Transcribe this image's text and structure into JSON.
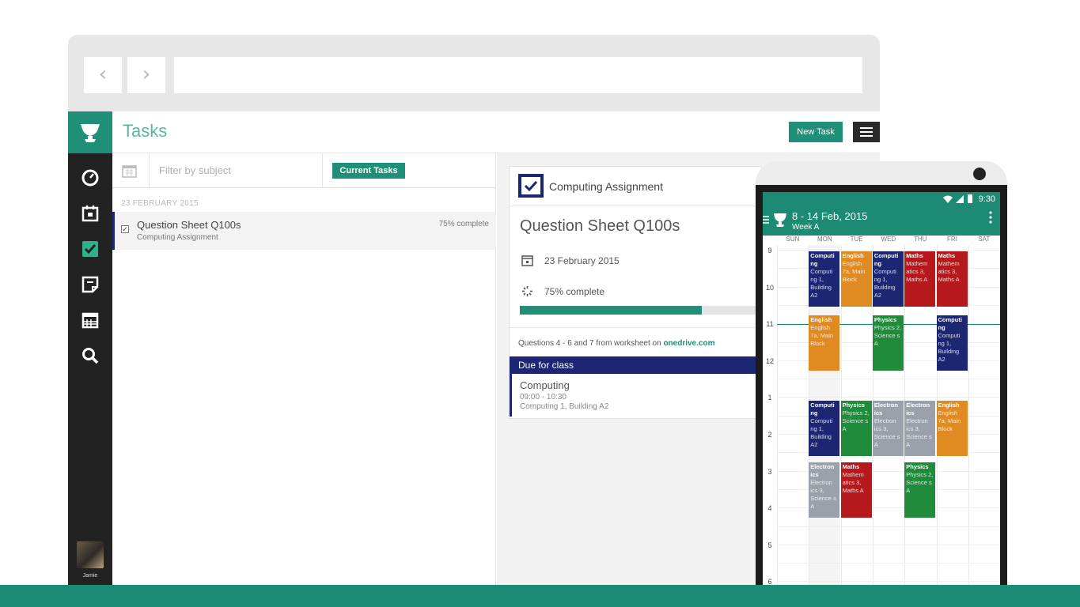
{
  "browser": {
    "back_icon": "chevron-left-icon",
    "forward_icon": "chevron-right-icon",
    "address": ""
  },
  "sidebar": {
    "logo_icon": "trophy-logo-icon",
    "items": [
      {
        "icon": "dashboard-icon"
      },
      {
        "icon": "calendar-day-icon"
      },
      {
        "icon": "tasks-check-icon",
        "active": true
      },
      {
        "icon": "notes-icon"
      },
      {
        "icon": "timetable-icon"
      },
      {
        "icon": "search-icon"
      }
    ],
    "user_name": "Jamie"
  },
  "header": {
    "title": "Tasks",
    "new_task_label": "New Task",
    "menu_icon": "hamburger-icon"
  },
  "filter": {
    "placeholder": "Filter by subject",
    "current_tasks_label": "Current Tasks"
  },
  "tasks": {
    "date_heading": "23 FEBRUARY 2015",
    "items": [
      {
        "title": "Question Sheet Q100s",
        "subtitle": "Computing Assignment",
        "progress": "75% complete",
        "checked": true
      }
    ]
  },
  "detail": {
    "assignment_label": "Computing Assignment",
    "title": "Question Sheet Q100s",
    "date": "23 February 2015",
    "progress_text": "75% complete",
    "progress_value": 0.75,
    "note_text": "Questions 4 - 6 and 7 from worksheet on ",
    "note_link": "onedrive.com",
    "due_heading": "Due for class",
    "due_subject": "Computing",
    "due_time": "09:00 - 10:30",
    "due_room": "Computing 1, Building A2"
  },
  "phone": {
    "time": "9:30",
    "range": "8 - 14 Feb, 2015",
    "week": "Week A",
    "days": [
      "SUN",
      "MON",
      "TUE",
      "WED",
      "THU",
      "FRI",
      "SAT"
    ],
    "hours": [
      "9",
      "10",
      "11",
      "12",
      "1",
      "2",
      "3",
      "4",
      "5",
      "6"
    ],
    "lessons": [
      {
        "day": 1,
        "start": 0,
        "slot": 0,
        "title": "Computi ng",
        "detail": "Computi ng 1, Building A2",
        "color": "#1c2672"
      },
      {
        "day": 2,
        "start": 0,
        "slot": 1,
        "title": "English",
        "detail": "English 7a, Main Block",
        "color": "#e08a22"
      },
      {
        "day": 3,
        "start": 0,
        "slot": 2,
        "title": "Computi ng",
        "detail": "Computi ng 1, Building A2",
        "color": "#1c2672"
      },
      {
        "day": 4,
        "start": 0,
        "slot": 3,
        "title": "Maths",
        "detail": "Mathem atics 3, Maths A",
        "color": "#b5191c"
      },
      {
        "day": 5,
        "start": 0,
        "slot": 4,
        "title": "Maths",
        "detail": "Mathem atics 3, Maths A",
        "color": "#b5191c"
      },
      {
        "day": 1,
        "start": 1,
        "slot": 5,
        "title": "English",
        "detail": "English 7a, Main Block",
        "color": "#e08a22"
      },
      {
        "day": 3,
        "start": 1,
        "slot": 6,
        "title": "Physics",
        "detail": "Physics 2, Science s A",
        "color": "#1f8b3b"
      },
      {
        "day": 5,
        "start": 1,
        "slot": 7,
        "title": "Computi ng",
        "detail": "Computi ng 1, Building A2",
        "color": "#1c2672"
      },
      {
        "day": 1,
        "start": 2,
        "slot": 8,
        "title": "Computi ng",
        "detail": "Computi ng 1, Building A2",
        "color": "#1c2672"
      },
      {
        "day": 2,
        "start": 2,
        "slot": 9,
        "title": "Physics",
        "detail": "Physics 2, Science s A",
        "color": "#1f8b3b"
      },
      {
        "day": 3,
        "start": 2,
        "slot": 10,
        "title": "Electron ics",
        "detail": "Electron ics 3, Science s A",
        "color": "#9aa1aa"
      },
      {
        "day": 4,
        "start": 2,
        "slot": 11,
        "title": "Electron ics",
        "detail": "Electron ics 3, Science s A",
        "color": "#9aa1aa"
      },
      {
        "day": 5,
        "start": 2,
        "slot": 12,
        "title": "English",
        "detail": "English 7a, Main Block",
        "color": "#e08a22"
      },
      {
        "day": 1,
        "start": 3,
        "slot": 13,
        "title": "Electron ics",
        "detail": "Electron ics 3, Science s A",
        "color": "#9aa1aa"
      },
      {
        "day": 2,
        "start": 3,
        "slot": 14,
        "title": "Maths",
        "detail": "Mathem atics 3, Maths A",
        "color": "#b5191c"
      },
      {
        "day": 4,
        "start": 3,
        "slot": 15,
        "title": "Physics",
        "detail": "Physics 2, Science s A",
        "color": "#1f8b3b"
      }
    ]
  }
}
